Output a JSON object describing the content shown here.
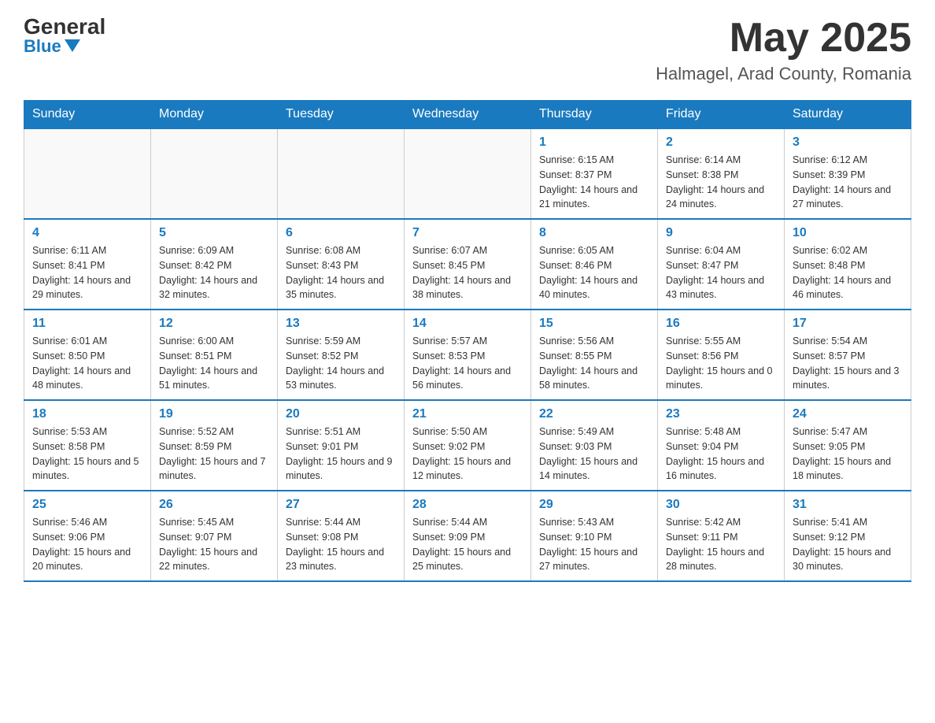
{
  "header": {
    "logo_general": "General",
    "logo_blue": "Blue",
    "month_year": "May 2025",
    "location": "Halmagel, Arad County, Romania"
  },
  "calendar": {
    "days_of_week": [
      "Sunday",
      "Monday",
      "Tuesday",
      "Wednesday",
      "Thursday",
      "Friday",
      "Saturday"
    ],
    "weeks": [
      [
        {
          "day": "",
          "info": ""
        },
        {
          "day": "",
          "info": ""
        },
        {
          "day": "",
          "info": ""
        },
        {
          "day": "",
          "info": ""
        },
        {
          "day": "1",
          "info": "Sunrise: 6:15 AM\nSunset: 8:37 PM\nDaylight: 14 hours and 21 minutes."
        },
        {
          "day": "2",
          "info": "Sunrise: 6:14 AM\nSunset: 8:38 PM\nDaylight: 14 hours and 24 minutes."
        },
        {
          "day": "3",
          "info": "Sunrise: 6:12 AM\nSunset: 8:39 PM\nDaylight: 14 hours and 27 minutes."
        }
      ],
      [
        {
          "day": "4",
          "info": "Sunrise: 6:11 AM\nSunset: 8:41 PM\nDaylight: 14 hours and 29 minutes."
        },
        {
          "day": "5",
          "info": "Sunrise: 6:09 AM\nSunset: 8:42 PM\nDaylight: 14 hours and 32 minutes."
        },
        {
          "day": "6",
          "info": "Sunrise: 6:08 AM\nSunset: 8:43 PM\nDaylight: 14 hours and 35 minutes."
        },
        {
          "day": "7",
          "info": "Sunrise: 6:07 AM\nSunset: 8:45 PM\nDaylight: 14 hours and 38 minutes."
        },
        {
          "day": "8",
          "info": "Sunrise: 6:05 AM\nSunset: 8:46 PM\nDaylight: 14 hours and 40 minutes."
        },
        {
          "day": "9",
          "info": "Sunrise: 6:04 AM\nSunset: 8:47 PM\nDaylight: 14 hours and 43 minutes."
        },
        {
          "day": "10",
          "info": "Sunrise: 6:02 AM\nSunset: 8:48 PM\nDaylight: 14 hours and 46 minutes."
        }
      ],
      [
        {
          "day": "11",
          "info": "Sunrise: 6:01 AM\nSunset: 8:50 PM\nDaylight: 14 hours and 48 minutes."
        },
        {
          "day": "12",
          "info": "Sunrise: 6:00 AM\nSunset: 8:51 PM\nDaylight: 14 hours and 51 minutes."
        },
        {
          "day": "13",
          "info": "Sunrise: 5:59 AM\nSunset: 8:52 PM\nDaylight: 14 hours and 53 minutes."
        },
        {
          "day": "14",
          "info": "Sunrise: 5:57 AM\nSunset: 8:53 PM\nDaylight: 14 hours and 56 minutes."
        },
        {
          "day": "15",
          "info": "Sunrise: 5:56 AM\nSunset: 8:55 PM\nDaylight: 14 hours and 58 minutes."
        },
        {
          "day": "16",
          "info": "Sunrise: 5:55 AM\nSunset: 8:56 PM\nDaylight: 15 hours and 0 minutes."
        },
        {
          "day": "17",
          "info": "Sunrise: 5:54 AM\nSunset: 8:57 PM\nDaylight: 15 hours and 3 minutes."
        }
      ],
      [
        {
          "day": "18",
          "info": "Sunrise: 5:53 AM\nSunset: 8:58 PM\nDaylight: 15 hours and 5 minutes."
        },
        {
          "day": "19",
          "info": "Sunrise: 5:52 AM\nSunset: 8:59 PM\nDaylight: 15 hours and 7 minutes."
        },
        {
          "day": "20",
          "info": "Sunrise: 5:51 AM\nSunset: 9:01 PM\nDaylight: 15 hours and 9 minutes."
        },
        {
          "day": "21",
          "info": "Sunrise: 5:50 AM\nSunset: 9:02 PM\nDaylight: 15 hours and 12 minutes."
        },
        {
          "day": "22",
          "info": "Sunrise: 5:49 AM\nSunset: 9:03 PM\nDaylight: 15 hours and 14 minutes."
        },
        {
          "day": "23",
          "info": "Sunrise: 5:48 AM\nSunset: 9:04 PM\nDaylight: 15 hours and 16 minutes."
        },
        {
          "day": "24",
          "info": "Sunrise: 5:47 AM\nSunset: 9:05 PM\nDaylight: 15 hours and 18 minutes."
        }
      ],
      [
        {
          "day": "25",
          "info": "Sunrise: 5:46 AM\nSunset: 9:06 PM\nDaylight: 15 hours and 20 minutes."
        },
        {
          "day": "26",
          "info": "Sunrise: 5:45 AM\nSunset: 9:07 PM\nDaylight: 15 hours and 22 minutes."
        },
        {
          "day": "27",
          "info": "Sunrise: 5:44 AM\nSunset: 9:08 PM\nDaylight: 15 hours and 23 minutes."
        },
        {
          "day": "28",
          "info": "Sunrise: 5:44 AM\nSunset: 9:09 PM\nDaylight: 15 hours and 25 minutes."
        },
        {
          "day": "29",
          "info": "Sunrise: 5:43 AM\nSunset: 9:10 PM\nDaylight: 15 hours and 27 minutes."
        },
        {
          "day": "30",
          "info": "Sunrise: 5:42 AM\nSunset: 9:11 PM\nDaylight: 15 hours and 28 minutes."
        },
        {
          "day": "31",
          "info": "Sunrise: 5:41 AM\nSunset: 9:12 PM\nDaylight: 15 hours and 30 minutes."
        }
      ]
    ]
  }
}
